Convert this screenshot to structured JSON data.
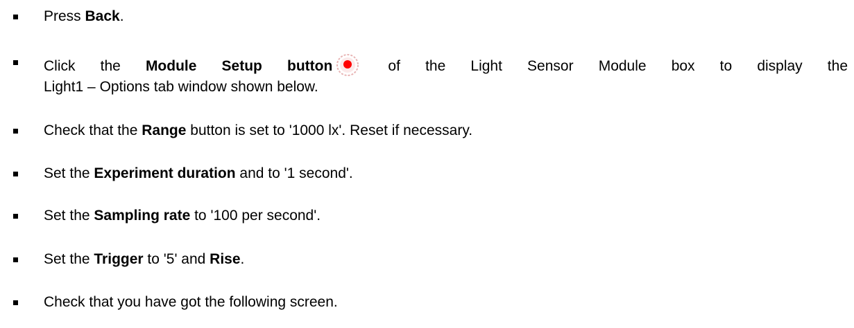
{
  "steps": [
    {
      "pre": "Press ",
      "bold": "Back",
      "post": "."
    },
    {
      "pre": "Click the ",
      "bold": "Module Setup button",
      "post_line1": " of the Light Sensor Module box to display the",
      "line2": "Light1 – Options tab window shown below.",
      "icon": "module-setup-icon"
    },
    {
      "pre": "Check that the ",
      "bold": "Range",
      "post": " button is set to '1000 lx'. Reset if necessary."
    },
    {
      "pre": "Set the ",
      "bold": "Experiment duration",
      "post": " and to '1 second'."
    },
    {
      "pre": "Set the ",
      "bold": "Sampling rate",
      "post": " to '100 per second'."
    },
    {
      "pre": "Set the ",
      "bold": "Trigger",
      "mid": " to '5' and ",
      "bold2": "Rise",
      "post": "."
    },
    {
      "text": "Check that you have got the following screen."
    }
  ],
  "colors": {
    "text": "#000000",
    "bullet": "#000000",
    "icon_red": "#ff0000",
    "icon_ring": "#e8b4b4"
  }
}
